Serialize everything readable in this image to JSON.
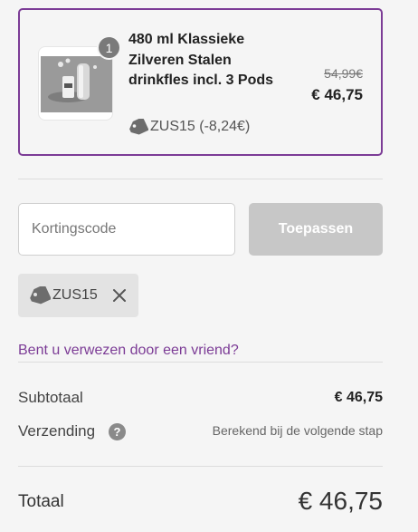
{
  "cart": {
    "item": {
      "quantity": "1",
      "title": "480 ml Klassieke Zilveren Stalen drinkfles incl. 3 Pods",
      "discount": "ZUS15 (-8,24€)",
      "old_price": "54,99€",
      "price": "€ 46,75"
    }
  },
  "discount": {
    "placeholder": "Kortingscode",
    "apply_label": "Toepassen",
    "applied_code": "ZUS15"
  },
  "referral": {
    "link_label": "Bent u verwezen door een vriend?"
  },
  "summary": {
    "subtotal_label": "Subtotaal",
    "subtotal_value": "€ 46,75",
    "shipping_label": "Verzending",
    "shipping_help": "?",
    "shipping_value": "Berekend bij de volgende stap",
    "total_label": "Totaal",
    "total_value": "€ 46,75"
  },
  "icons": {
    "tag": "tag-icon",
    "close": "close-icon",
    "help": "question-icon"
  },
  "colors": {
    "accent": "#7c3c96",
    "button_disabled": "#c7c7c7",
    "background": "#f5f5f5"
  }
}
